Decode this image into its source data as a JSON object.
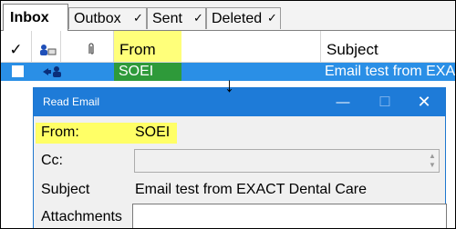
{
  "tabs": [
    {
      "label": "Inbox",
      "checked": false
    },
    {
      "label": "Outbox",
      "checked": true
    },
    {
      "label": "Sent",
      "checked": true
    },
    {
      "label": "Deleted",
      "checked": true
    }
  ],
  "tab_check_glyph": "✓",
  "columns": {
    "check": "✓",
    "from": "From",
    "subject": "Subject"
  },
  "message_row": {
    "from": "SOEI",
    "subject": "Email test from EXA"
  },
  "highlight_color": "#ffff66",
  "selection_color": "#2a8fe6",
  "dialog": {
    "title": "Read Email",
    "minimize": "—",
    "maximize": "☐",
    "close": "✕",
    "fields": {
      "from_label": "From:",
      "from_value": "SOEI",
      "cc_label": "Cc:",
      "cc_value": "",
      "subject_label": "Subject",
      "subject_value": "Email test from EXACT Dental Care",
      "attachments_label": "Attachments"
    }
  },
  "arrow_glyph": "↓"
}
